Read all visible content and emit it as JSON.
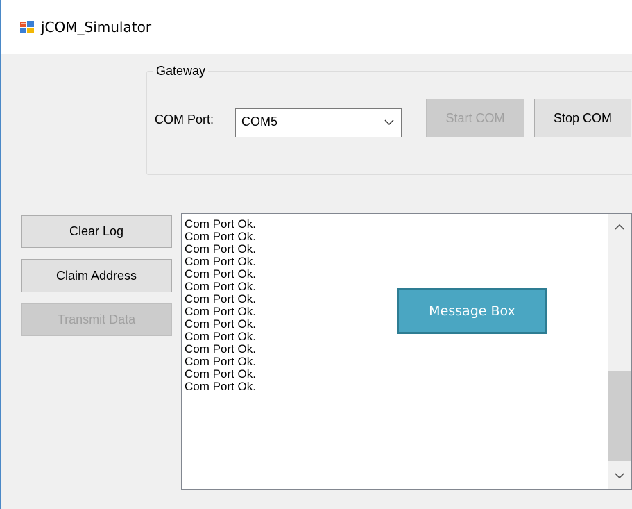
{
  "window": {
    "title": "jCOM_Simulator",
    "icon": "windows-form-icon"
  },
  "gateway": {
    "group_label": "Gateway",
    "com_port_label": "COM Port:",
    "com_port_value": "COM5",
    "start_button": "Start COM",
    "stop_button": "Stop COM"
  },
  "actions": {
    "clear_log": "Clear Log",
    "claim_address": "Claim Address",
    "transmit_data": "Transmit Data"
  },
  "log": {
    "lines": [
      "Com Port Ok.",
      "Com Port Ok.",
      "Com Port Ok.",
      "Com Port Ok.",
      "Com Port Ok.",
      "Com Port Ok.",
      "Com Port Ok.",
      "Com Port Ok.",
      "Com Port Ok.",
      "Com Port Ok.",
      "Com Port Ok.",
      "Com Port Ok.",
      "Com Port Ok.",
      "Com Port Ok."
    ]
  },
  "annotation": {
    "label": "Message Box",
    "color": "#4aa6c2"
  },
  "colors": {
    "window_background": "#f0f0f0",
    "disabled_button": "#cccccc",
    "button": "#e1e1e1"
  }
}
